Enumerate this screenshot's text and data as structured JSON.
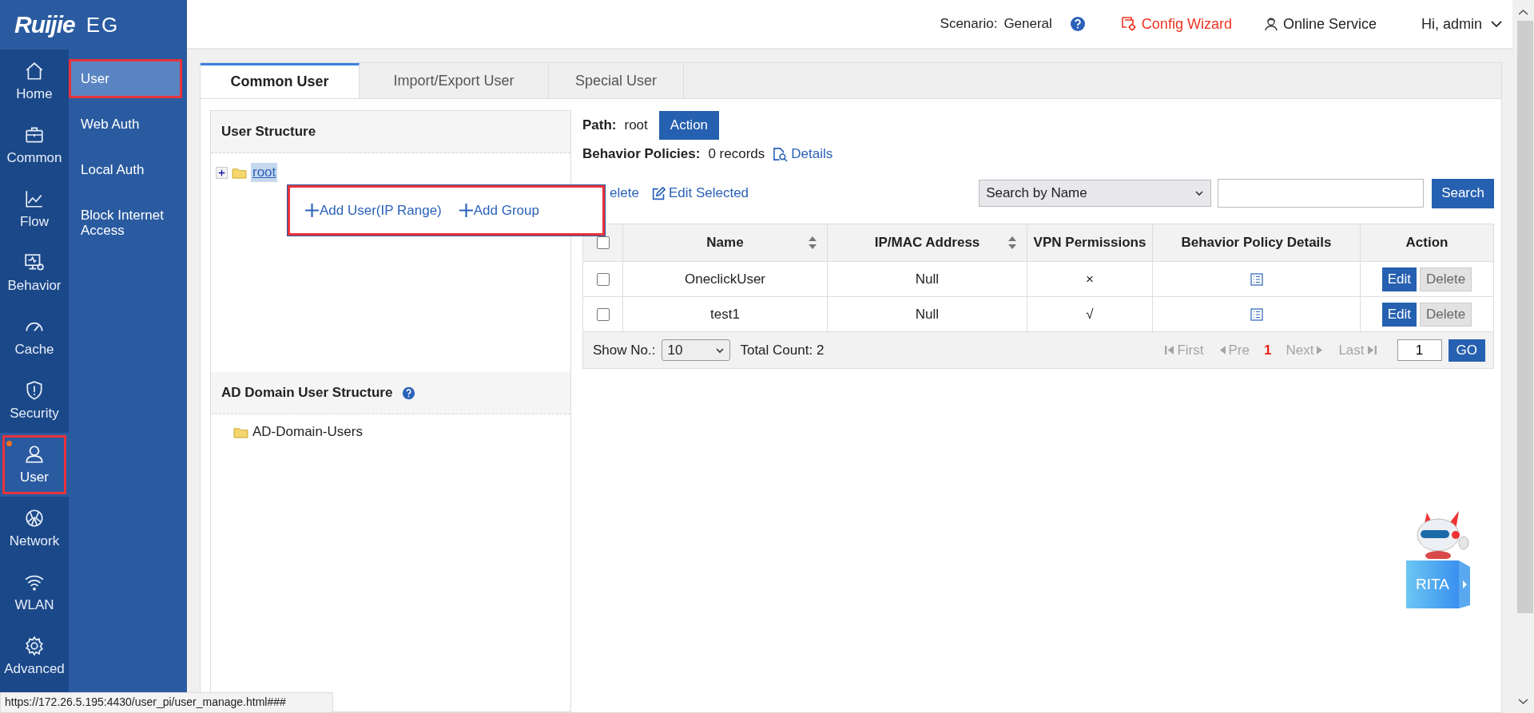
{
  "logo": {
    "brand": "Ruijie",
    "model": "EG"
  },
  "header": {
    "scenario_label": "Scenario:",
    "scenario": "General",
    "config_wizard": "Config Wizard",
    "online_service": "Online Service",
    "user": "Hi, admin"
  },
  "nav": [
    {
      "label": "Home",
      "selected": false,
      "annotated": false,
      "alert": false
    },
    {
      "label": "Common",
      "selected": false,
      "annotated": false,
      "alert": false
    },
    {
      "label": "Flow",
      "selected": false,
      "annotated": false,
      "alert": false
    },
    {
      "label": "Behavior",
      "selected": false,
      "annotated": false,
      "alert": false
    },
    {
      "label": "Cache",
      "selected": false,
      "annotated": false,
      "alert": false
    },
    {
      "label": "Security",
      "selected": false,
      "annotated": false,
      "alert": false
    },
    {
      "label": "User",
      "selected": true,
      "annotated": true,
      "alert": true
    },
    {
      "label": "Network",
      "selected": false,
      "annotated": false,
      "alert": false
    },
    {
      "label": "WLAN",
      "selected": false,
      "annotated": false,
      "alert": false
    },
    {
      "label": "Advanced",
      "selected": false,
      "annotated": false,
      "alert": false
    }
  ],
  "subnav": [
    {
      "label": "User",
      "selected": true,
      "annotated": true
    },
    {
      "label": "Web Auth",
      "selected": false,
      "annotated": false
    },
    {
      "label": "Local Auth",
      "selected": false,
      "annotated": false
    },
    {
      "label": "Block Internet Access",
      "selected": false,
      "annotated": false
    }
  ],
  "tabs": [
    {
      "label": "Common User",
      "selected": true
    },
    {
      "label": "Import/Export User",
      "selected": false
    },
    {
      "label": "Special User",
      "selected": false
    }
  ],
  "user_structure": {
    "title": "User Structure",
    "tree": [
      {
        "label": "root",
        "selected": true,
        "expanded": false
      }
    ]
  },
  "context_menu": {
    "annotated": true,
    "items": [
      "Add User(IP Range)",
      "Add Group"
    ]
  },
  "ad_structure": {
    "title": "AD Domain User Structure",
    "tree": [
      {
        "label": "AD-Domain-Users"
      }
    ]
  },
  "path": {
    "label": "Path:",
    "value": "root",
    "action": "Action"
  },
  "policies": {
    "label": "Behavior Policies:",
    "value": "0 records",
    "link": "Details"
  },
  "toolbar": {
    "delete": "elete",
    "edit_selected": "Edit Selected",
    "search_by": "Search by Name",
    "search_button": "Search"
  },
  "table": {
    "all_checked": false,
    "columns": [
      {
        "label": "Name",
        "sortable": true
      },
      {
        "label": "IP/MAC Address",
        "sortable": true
      },
      {
        "label": "VPN Permissions",
        "sortable": false
      },
      {
        "label": "Behavior Policy Details",
        "sortable": false
      },
      {
        "label": "Action",
        "sortable": false
      }
    ],
    "rows": [
      {
        "checked": false,
        "name": "OneclickUser",
        "address": "Null",
        "vpn": "×",
        "edit": "Edit",
        "delete": "Delete"
      },
      {
        "checked": false,
        "name": "test1",
        "address": "Null",
        "vpn": "√",
        "edit": "Edit",
        "delete": "Delete"
      }
    ]
  },
  "footer": {
    "show_label": "Show No.:",
    "show_value": "10",
    "total": "Total Count: 2",
    "current": "1",
    "page_input": "1",
    "go": "GO",
    "pager": [
      {
        "kind": "first",
        "label": "First",
        "disabled": true
      },
      {
        "kind": "pre",
        "label": "Pre",
        "disabled": true
      },
      {
        "kind": "next",
        "label": "Next",
        "disabled": true
      },
      {
        "kind": "last",
        "label": "Last",
        "disabled": true
      }
    ]
  },
  "assistant": {
    "label": "RITA"
  },
  "status_bar": {
    "url": "https://172.26.5.195:4430/user_pi/user_manage.html###"
  }
}
